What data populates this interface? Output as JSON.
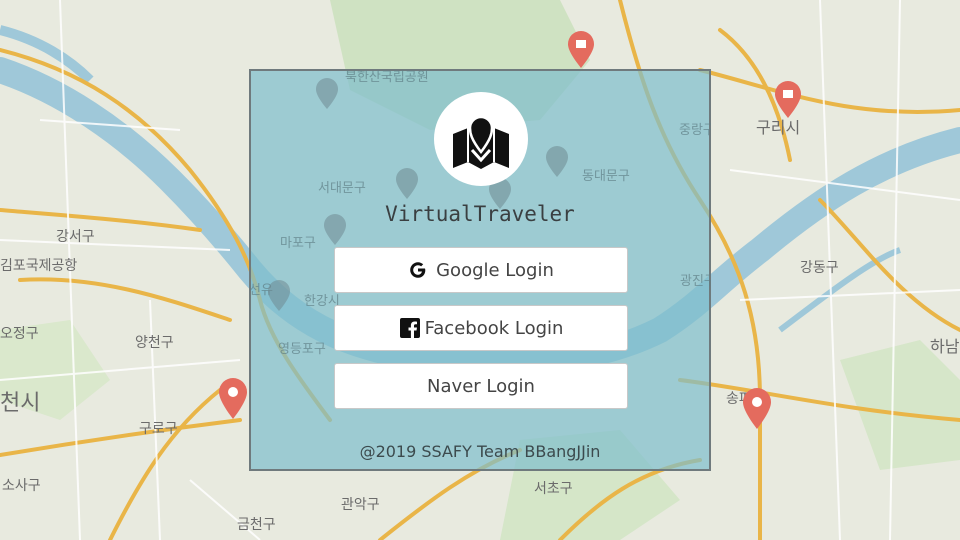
{
  "app": {
    "title": "VirtualTraveler",
    "logo_icon": "folded-map-pin-icon"
  },
  "login": {
    "google_label": "Google Login",
    "google_icon": "google-g-icon",
    "facebook_label": "Facebook Login",
    "facebook_icon": "facebook-icon",
    "naver_label": "Naver Login"
  },
  "footer": {
    "text": "@2019 SSAFY Team BBangJJin"
  },
  "map": {
    "labels": [
      "강서구",
      "김포국제공항",
      "양천구",
      "구로구",
      "금천구",
      "관악구",
      "서초구",
      "강동구",
      "구리시",
      "하남",
      "송파구",
      "마포구",
      "서대문구",
      "동대문구",
      "중랑구",
      "광진구",
      "북한산국립공원",
      "천시",
      "소사구",
      "오정구",
      "한강시",
      "영등포구",
      "선유",
      "성북구"
    ]
  },
  "colors": {
    "panel_overlay": "#7ebecc",
    "map_land": "#e8eadf",
    "map_river": "#9fc8d9",
    "map_road": "#e9b548",
    "map_pin_red": "#e46b5e",
    "map_pin_gray": "#8b979a"
  }
}
